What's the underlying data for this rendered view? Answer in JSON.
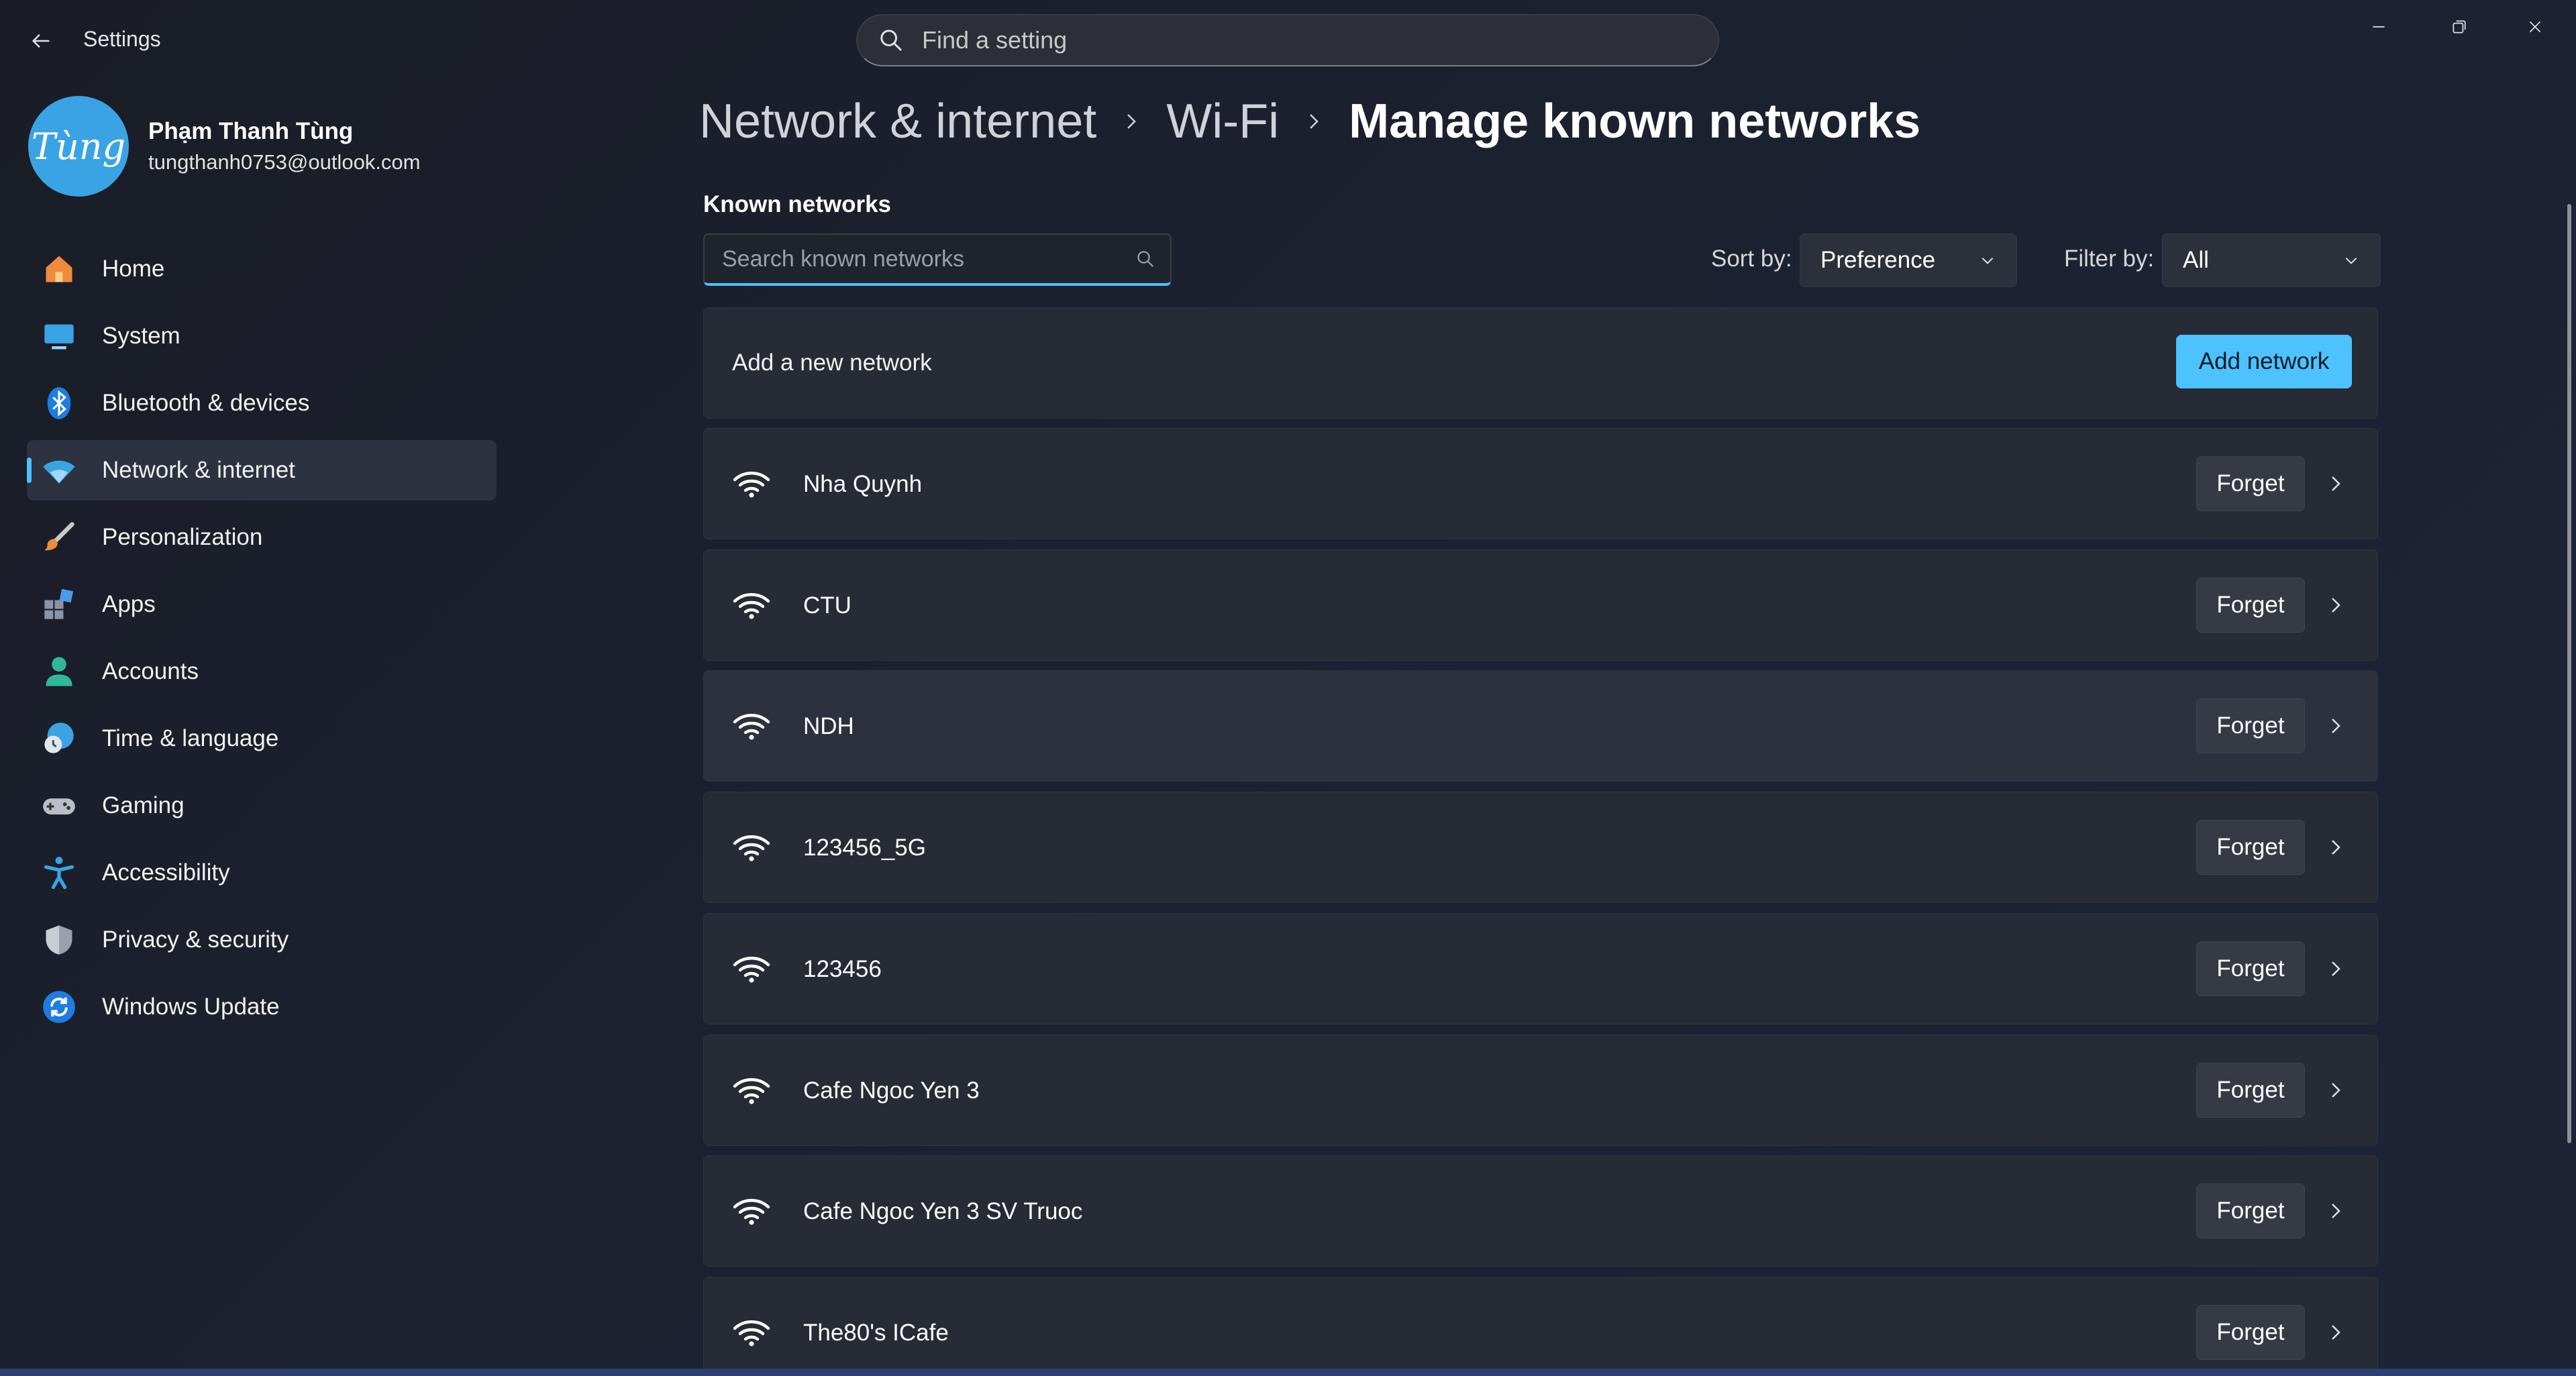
{
  "window": {
    "title": "Settings",
    "search_placeholder": "Find a setting"
  },
  "profile": {
    "initials": "Tùng",
    "name": "Phạm Thanh Tùng",
    "email": "tungthanh0753@outlook.com"
  },
  "sidebar": {
    "items": [
      {
        "label": "Home",
        "icon": "home-icon"
      },
      {
        "label": "System",
        "icon": "system-icon"
      },
      {
        "label": "Bluetooth & devices",
        "icon": "bluetooth-icon"
      },
      {
        "label": "Network & internet",
        "icon": "network-icon",
        "selected": true
      },
      {
        "label": "Personalization",
        "icon": "brush-icon"
      },
      {
        "label": "Apps",
        "icon": "apps-icon"
      },
      {
        "label": "Accounts",
        "icon": "accounts-icon"
      },
      {
        "label": "Time & language",
        "icon": "globe-clock-icon"
      },
      {
        "label": "Gaming",
        "icon": "gamepad-icon"
      },
      {
        "label": "Accessibility",
        "icon": "accessibility-icon"
      },
      {
        "label": "Privacy & security",
        "icon": "shield-icon"
      },
      {
        "label": "Windows Update",
        "icon": "update-icon"
      }
    ]
  },
  "breadcrumb": {
    "items": [
      "Network & internet",
      "Wi-Fi",
      "Manage known networks"
    ]
  },
  "known_networks": {
    "section_title": "Known networks",
    "search_placeholder": "Search known networks",
    "sort_label": "Sort by:",
    "sort_value": "Preference",
    "filter_label": "Filter by:",
    "filter_value": "All",
    "add_label": "Add a new network",
    "add_button": "Add network",
    "forget_label": "Forget",
    "networks": [
      "Nha Quynh",
      "CTU",
      "NDH",
      "123456_5G",
      "123456",
      "Cafe Ngoc Yen 3",
      "Cafe Ngoc Yen 3 SV Truoc",
      "The80's ICafe"
    ]
  },
  "colors": {
    "accent": "#4cc2ff",
    "background": "#1b1f2a",
    "card": "#262b36"
  }
}
